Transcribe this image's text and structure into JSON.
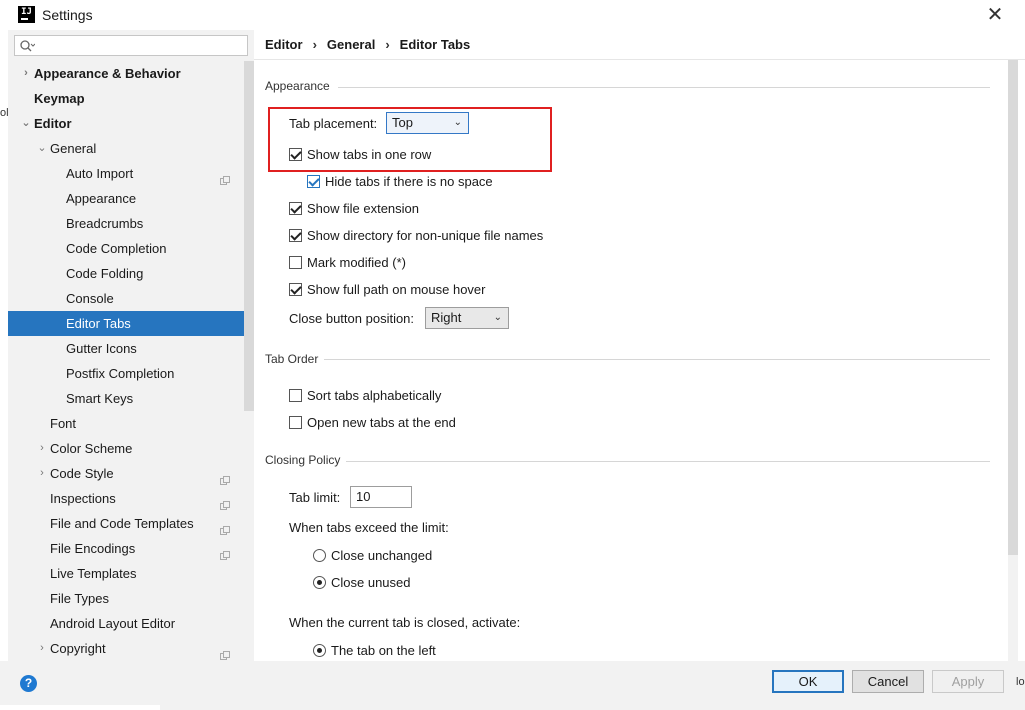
{
  "window": {
    "title": "Settings",
    "icon_text": "IJ",
    "close_glyph": "✕",
    "left_edge_text": "ol",
    "right_edge_text": "lo"
  },
  "search": {
    "placeholder": "",
    "value": ""
  },
  "breadcrumb": {
    "items": [
      "Editor",
      "General",
      "Editor Tabs"
    ],
    "separator": "›"
  },
  "tree": {
    "items": [
      {
        "label": "Appearance & Behavior",
        "level": 0,
        "arrow": "›",
        "bold": true
      },
      {
        "label": "Keymap",
        "level": 0,
        "arrow": "",
        "bold": true
      },
      {
        "label": "Editor",
        "level": 0,
        "arrow": "⌄",
        "bold": true
      },
      {
        "label": "General",
        "level": 1,
        "arrow": "⌄"
      },
      {
        "label": "Auto Import",
        "level": 2,
        "copy": true
      },
      {
        "label": "Appearance",
        "level": 2
      },
      {
        "label": "Breadcrumbs",
        "level": 2
      },
      {
        "label": "Code Completion",
        "level": 2
      },
      {
        "label": "Code Folding",
        "level": 2
      },
      {
        "label": "Console",
        "level": 2
      },
      {
        "label": "Editor Tabs",
        "level": 2,
        "selected": true
      },
      {
        "label": "Gutter Icons",
        "level": 2
      },
      {
        "label": "Postfix Completion",
        "level": 2
      },
      {
        "label": "Smart Keys",
        "level": 2
      },
      {
        "label": "Font",
        "level": 1
      },
      {
        "label": "Color Scheme",
        "level": 1,
        "arrow": "›"
      },
      {
        "label": "Code Style",
        "level": 1,
        "arrow": "›",
        "copy": true
      },
      {
        "label": "Inspections",
        "level": 1,
        "copy": true
      },
      {
        "label": "File and Code Templates",
        "level": 1,
        "copy": true
      },
      {
        "label": "File Encodings",
        "level": 1,
        "copy": true
      },
      {
        "label": "Live Templates",
        "level": 1
      },
      {
        "label": "File Types",
        "level": 1
      },
      {
        "label": "Android Layout Editor",
        "level": 1
      },
      {
        "label": "Copyright",
        "level": 1,
        "arrow": "›",
        "copy": true
      }
    ]
  },
  "appearance": {
    "title": "Appearance",
    "tab_placement_label": "Tab placement:",
    "tab_placement_value": "Top",
    "show_tabs_one_row": {
      "label": "Show tabs in one row",
      "checked": true
    },
    "hide_tabs_no_space": {
      "label": "Hide tabs if there is no space",
      "checked": true
    },
    "show_file_extension": {
      "label": "Show file extension",
      "checked": true
    },
    "show_directory": {
      "label": "Show directory for non-unique file names",
      "checked": true
    },
    "mark_modified": {
      "label": "Mark modified (*)",
      "checked": false
    },
    "show_full_path": {
      "label": "Show full path on mouse hover",
      "checked": true
    },
    "close_button_label": "Close button position:",
    "close_button_value": "Right"
  },
  "tab_order": {
    "title": "Tab Order",
    "sort_alpha": {
      "label": "Sort tabs alphabetically",
      "checked": false
    },
    "open_at_end": {
      "label": "Open new tabs at the end",
      "checked": false
    }
  },
  "closing_policy": {
    "title": "Closing Policy",
    "tab_limit_label": "Tab limit:",
    "tab_limit_value": "10",
    "exceed_label": "When tabs exceed the limit:",
    "close_unchanged": {
      "label": "Close unchanged",
      "checked": false
    },
    "close_unused": {
      "label": "Close unused",
      "checked": true
    },
    "activate_label": "When the current tab is closed, activate:",
    "tab_on_left": {
      "label": "The tab on the left",
      "checked": true
    }
  },
  "buttons": {
    "help": "?",
    "ok": "OK",
    "cancel": "Cancel",
    "apply": "Apply"
  },
  "colors": {
    "selection": "#2675bf",
    "highlight_box": "#e02020",
    "help": "#1f79d1"
  }
}
